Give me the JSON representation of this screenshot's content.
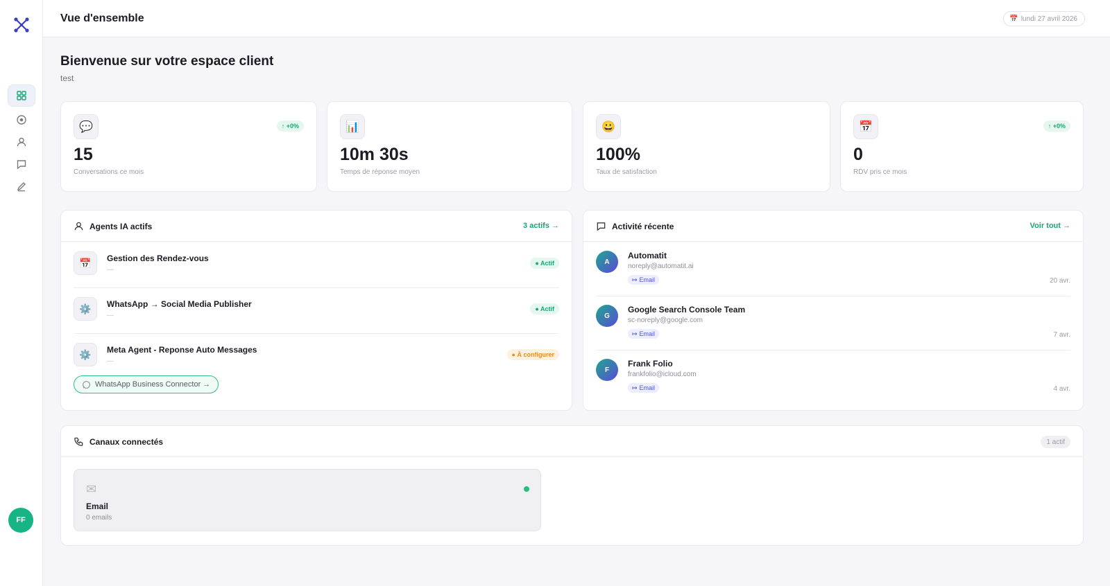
{
  "sidebar": {
    "avatar_initials": "FF",
    "nav_icons": [
      "dashboard-icon",
      "target-icon",
      "user-icon",
      "message-icon",
      "edit-icon"
    ]
  },
  "header": {
    "title": "Vue d'ensemble",
    "date": "lundi 27 avril 2026"
  },
  "welcome": {
    "title": "Bienvenue sur votre espace client",
    "subtitle": "test"
  },
  "stats": [
    {
      "icon": "💬",
      "value": "15",
      "label": "Conversations ce mois",
      "trend": "+0%"
    },
    {
      "icon": "📊",
      "value": "10m 30s",
      "label": "Temps de réponse moyen",
      "trend": ""
    },
    {
      "icon": "😀",
      "value": "100%",
      "label": "Taux de satisfaction",
      "trend": ""
    },
    {
      "icon": "📅",
      "value": "0",
      "label": "RDV pris ce mois",
      "trend": "+0%"
    }
  ],
  "agents": {
    "title": "Agents IA actifs",
    "link": "3 actifs →",
    "items": [
      {
        "icon": "📅",
        "name": "Gestion des Rendez-vous",
        "sub": "—",
        "status": "● Actif"
      },
      {
        "icon": "⚙️",
        "name": "WhatsApp → Social Media Publisher",
        "sub": "—",
        "status": "● Actif"
      },
      {
        "icon": "⚙️",
        "name": "Meta Agent - Reponse Auto Messages",
        "sub": "—",
        "status": "● À configurer"
      }
    ],
    "connector_button": "WhatsApp Business Connector →"
  },
  "activity": {
    "title": "Activité récente",
    "link": "Voir tout →",
    "items": [
      {
        "initial": "A",
        "name": "Automatit",
        "email": "noreply@automatit.ai",
        "tag": "Email",
        "time": "20 avr."
      },
      {
        "initial": "G",
        "name": "Google Search Console Team",
        "email": "sc-noreply@google.com",
        "tag": "Email",
        "time": "7 avr."
      },
      {
        "initial": "F",
        "name": "Frank Folio",
        "email": "frankfolio@icloud.com",
        "tag": "Email",
        "time": "4 avr."
      }
    ]
  },
  "channels": {
    "title": "Canaux connectés",
    "badge": "1 actif",
    "items": [
      {
        "icon": "✉",
        "name": "Email",
        "count": "0 emails"
      }
    ]
  },
  "colors": {
    "accent_green": "#17a673",
    "warning_orange": "#ee8b1c",
    "email_tag_blue": "#4e57c9"
  }
}
